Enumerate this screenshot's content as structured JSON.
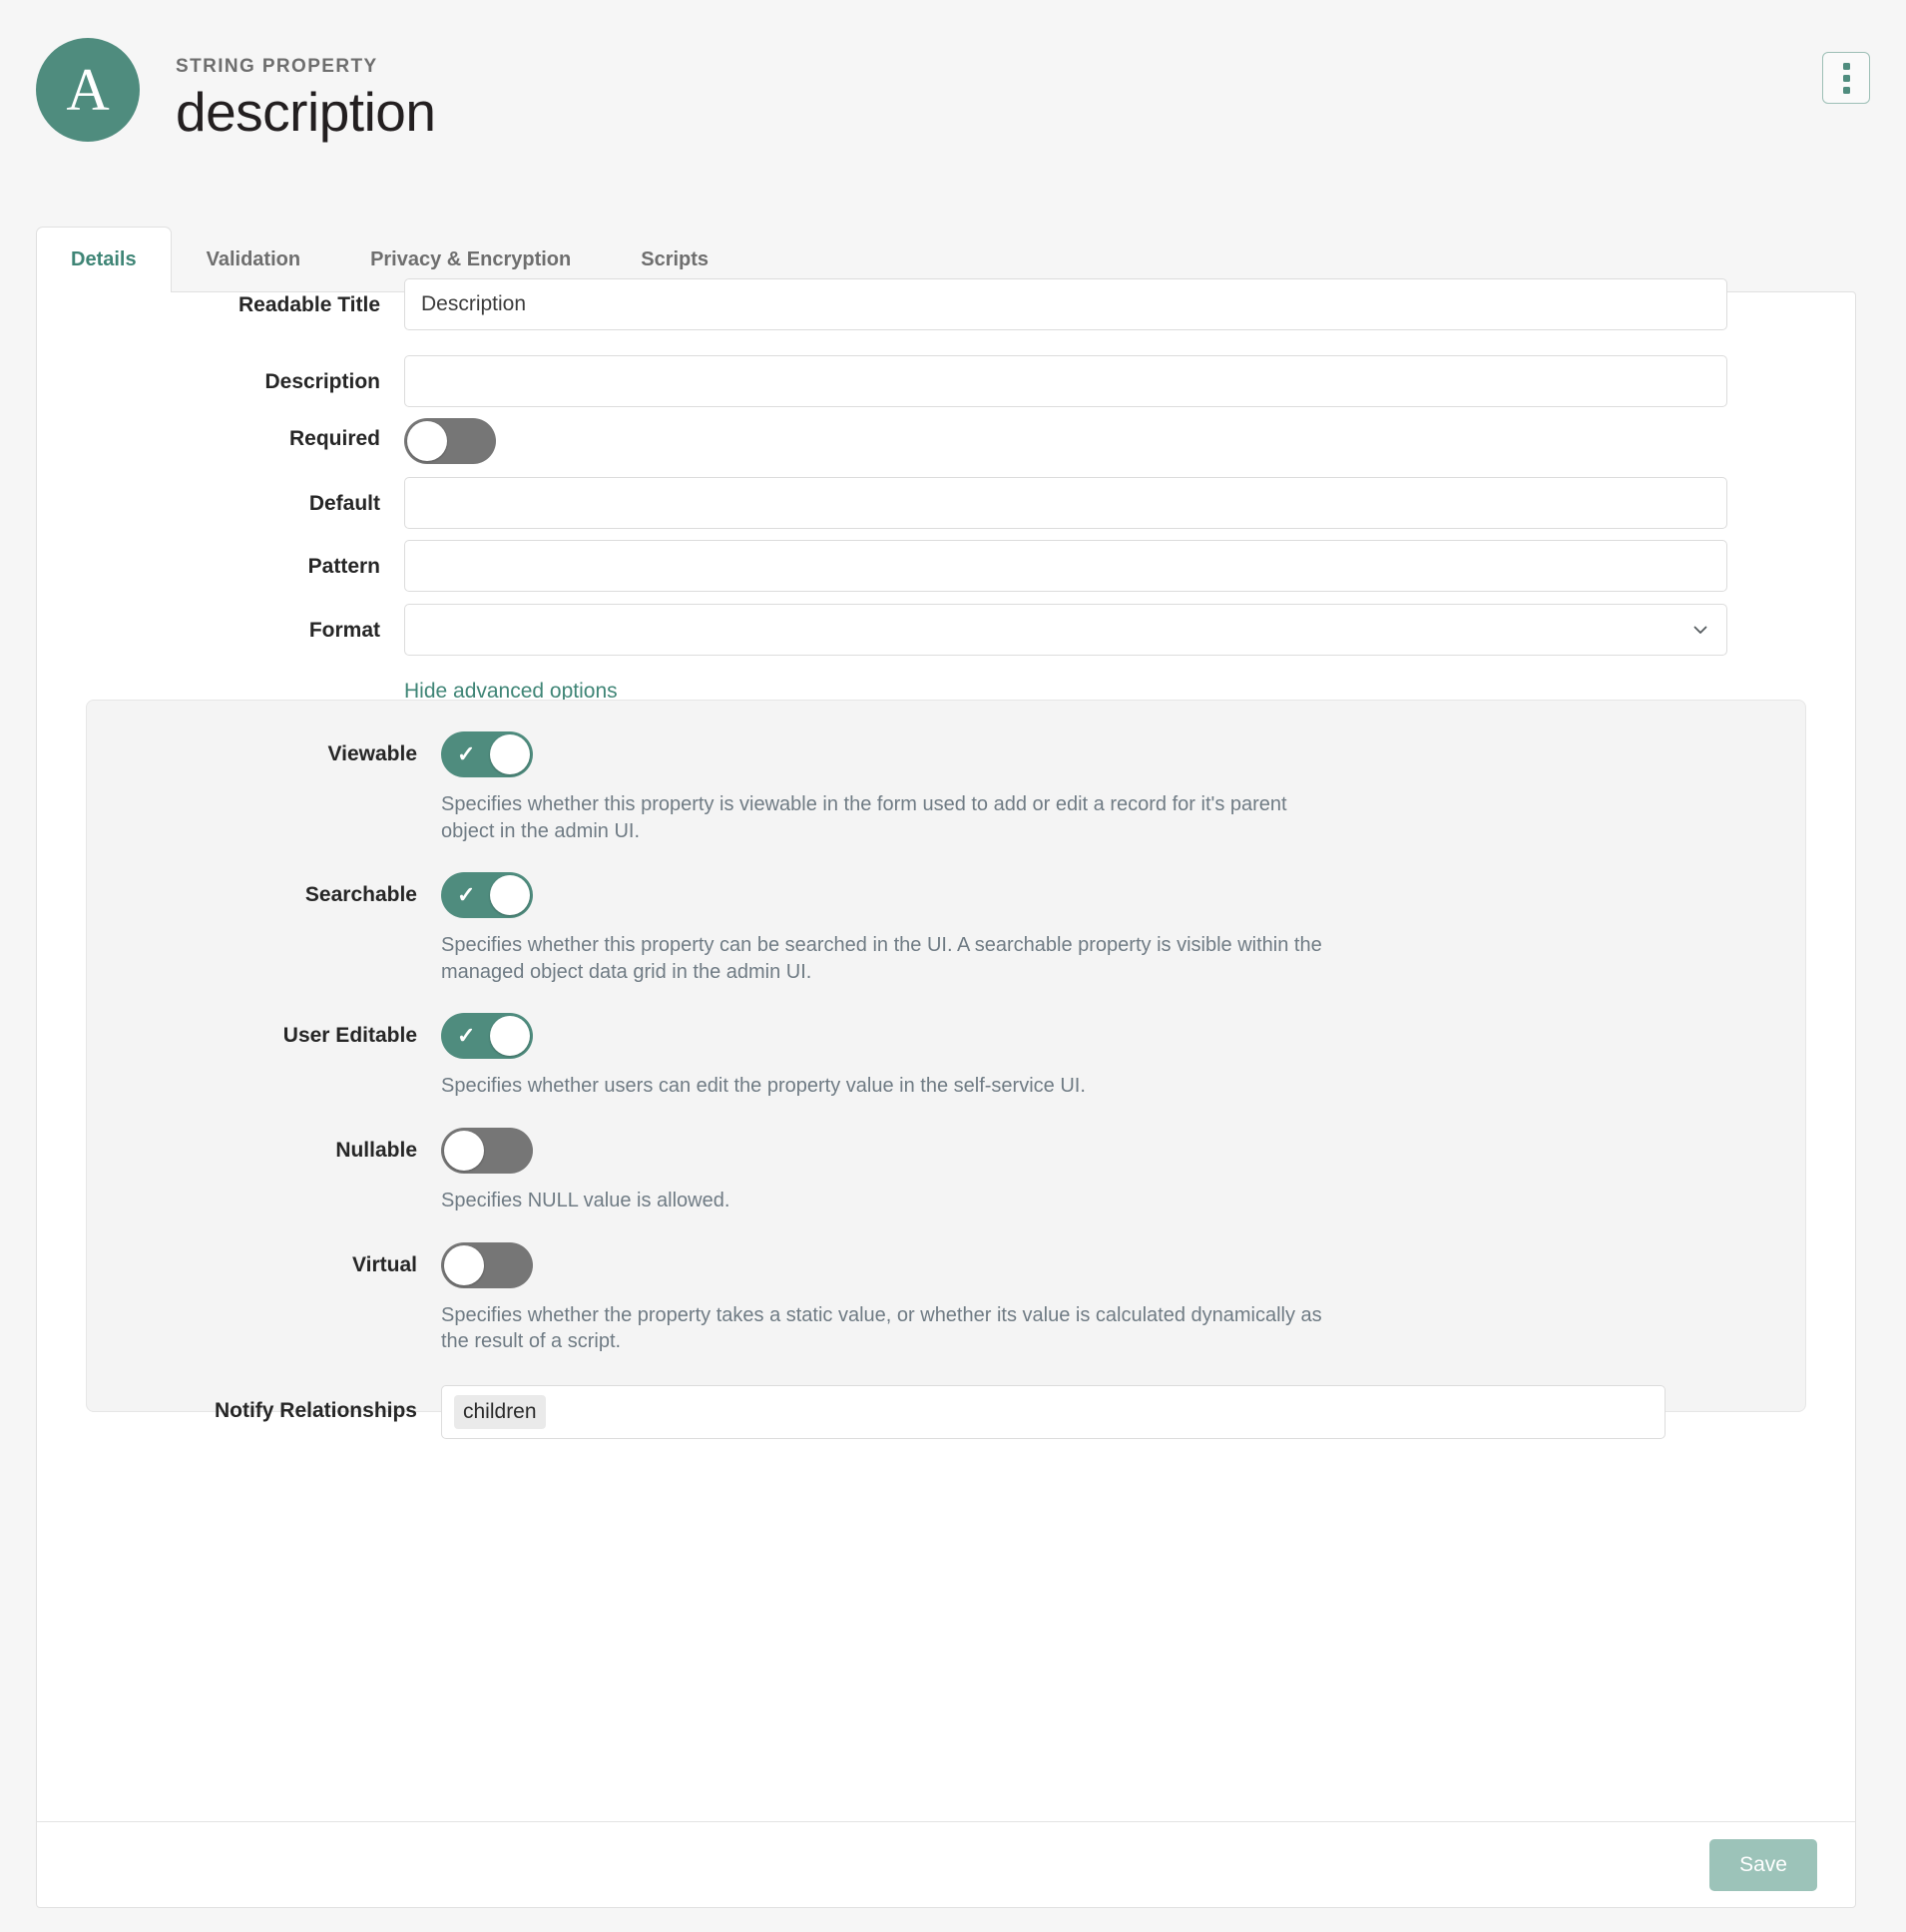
{
  "header": {
    "avatar_letter": "A",
    "eyebrow": "STRING PROPERTY",
    "title": "description",
    "menu_label": "More actions"
  },
  "tabs": [
    {
      "label": "Details",
      "active": true
    },
    {
      "label": "Validation",
      "active": false
    },
    {
      "label": "Privacy & Encryption",
      "active": false
    },
    {
      "label": "Scripts",
      "active": false
    }
  ],
  "form": {
    "readable_title": {
      "label": "Readable Title",
      "value": "Description",
      "placeholder": ""
    },
    "description": {
      "label": "Description",
      "value": "",
      "placeholder": ""
    },
    "required": {
      "label": "Required",
      "state": "off"
    },
    "default": {
      "label": "Default",
      "value": "",
      "placeholder": ""
    },
    "pattern": {
      "label": "Pattern",
      "value": "",
      "placeholder": ""
    },
    "format": {
      "label": "Format",
      "value": "",
      "placeholder": ""
    },
    "advanced_toggle_label": "Hide advanced options"
  },
  "advanced": {
    "viewable": {
      "label": "Viewable",
      "state": "on",
      "help": "Specifies whether this property is viewable in the form used to add or edit a record for it's parent object in the admin UI."
    },
    "searchable": {
      "label": "Searchable",
      "state": "on",
      "help": "Specifies whether this property can be searched in the UI. A searchable property is visible within the managed object data grid in the admin UI."
    },
    "user_editable": {
      "label": "User Editable",
      "state": "on",
      "help": "Specifies whether users can edit the property value in the self-service UI."
    },
    "nullable": {
      "label": "Nullable",
      "state": "off",
      "help": "Specifies NULL value is allowed."
    },
    "virtual": {
      "label": "Virtual",
      "state": "off",
      "help": "Specifies whether the property takes a static value, or whether its value is calculated dynamically as the result of a script."
    },
    "notify_relationships": {
      "label": "Notify Relationships",
      "chips": [
        "children"
      ]
    }
  },
  "footer": {
    "save_label": "Save"
  },
  "colors": {
    "accent": "#4f8c7e",
    "accent_text": "#3f8576",
    "save_disabled": "#9cc3b9",
    "toggle_off": "#767676",
    "page_bg": "#f6f6f6",
    "panel_bg": "#f4f4f4"
  }
}
